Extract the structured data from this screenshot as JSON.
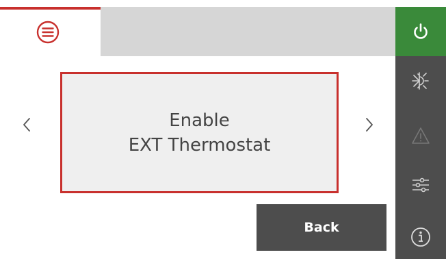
{
  "tabs": [
    {
      "icon": "menu-icon",
      "active": true
    },
    {
      "icon": "",
      "active": false
    }
  ],
  "option": {
    "line1": "Enable",
    "line2": "EXT Thermostat"
  },
  "navigation": {
    "prev_icon": "chevron-left-icon",
    "next_icon": "chevron-right-icon"
  },
  "buttons": {
    "back_label": "Back"
  },
  "sidebar": {
    "items": [
      {
        "icon": "power-icon",
        "active": true
      },
      {
        "icon": "snowflake-sun-icon",
        "active": false
      },
      {
        "icon": "warning-icon",
        "active": false
      },
      {
        "icon": "sliders-icon",
        "active": false
      },
      {
        "icon": "info-icon",
        "active": false
      }
    ]
  },
  "colors": {
    "accent": "#c8302d",
    "sidebar": "#4d4d4d",
    "power_active": "#3a8a3a",
    "option_bg": "#efefef"
  }
}
